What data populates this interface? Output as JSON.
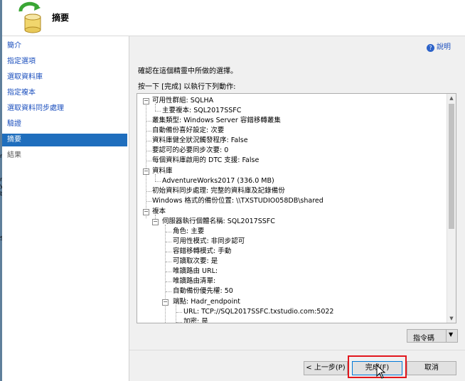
{
  "header": {
    "title": "摘要"
  },
  "edge_text": [
    "n",
    "n",
    "y",
    "b",
    "S"
  ],
  "nav": {
    "items": [
      {
        "label": "簡介",
        "state": "done"
      },
      {
        "label": "指定選項",
        "state": "done"
      },
      {
        "label": "選取資料庫",
        "state": "done"
      },
      {
        "label": "指定複本",
        "state": "done"
      },
      {
        "label": "選取資料同步處理",
        "state": "done"
      },
      {
        "label": "驗證",
        "state": "done"
      },
      {
        "label": "摘要",
        "state": "active"
      },
      {
        "label": "結果",
        "state": "future"
      }
    ]
  },
  "help": {
    "label": "說明"
  },
  "main": {
    "confirm_text": "確認在這個精靈中所做的選擇。",
    "instruction": "按一下 [完成] 以執行下列動作:"
  },
  "tree": {
    "nodes": [
      {
        "text": "可用性群組: SQLHA",
        "level": 0,
        "expander": "-"
      },
      {
        "text": "主要複本: SQL2017SSFC",
        "level": 1
      },
      {
        "text": "叢集類型: Windows Server 容錯移轉叢集",
        "level": 0
      },
      {
        "text": "自動備份喜好設定: 次要",
        "level": 0
      },
      {
        "text": "資料庫健全狀況觸發程序: False",
        "level": 0
      },
      {
        "text": "要認可的必要同步次要: 0",
        "level": 0
      },
      {
        "text": "每個資料庫啟用的 DTC 支援: False",
        "level": 0
      },
      {
        "text": "資料庫",
        "level": 0,
        "expander": "-"
      },
      {
        "text": "AdventureWorks2017 (336.0 MB)",
        "level": 1
      },
      {
        "text": "初始資料同步處理: 完整的資料庫及記錄備份",
        "level": 0
      },
      {
        "text": "Windows 格式的備份位置: \\\\TXSTUDIO058DB\\shared",
        "level": 0
      },
      {
        "text": "複本",
        "level": 0,
        "expander": "-"
      },
      {
        "text": "伺服器執行個體名稱: SQL2017SSFC",
        "level": 1,
        "expander": "-"
      },
      {
        "text": "角色: 主要",
        "level": 2
      },
      {
        "text": "可用性模式: 非同步認可",
        "level": 2
      },
      {
        "text": "容錯移轉模式: 手動",
        "level": 2
      },
      {
        "text": "可讀取次要: 是",
        "level": 2
      },
      {
        "text": "唯讀路由 URL:",
        "level": 2
      },
      {
        "text": "唯讀路由清單:",
        "level": 2
      },
      {
        "text": "自動備份優先權: 50",
        "level": 2
      },
      {
        "text": "端點: Hadr_endpoint",
        "level": 2,
        "expander": "-"
      },
      {
        "text": "URL: TCP://SQL2017SSFC.txstudio.com:5022",
        "level": 3
      },
      {
        "text": "加密: 是",
        "level": 3
      }
    ]
  },
  "buttons": {
    "script": "指令碼",
    "back": "< 上一步(P)",
    "finish": "完成(F)",
    "cancel": "取消"
  },
  "colors": {
    "nav_active_bg": "#1f6ebd",
    "link": "#1b4fbe",
    "highlight_box": "#e2161d"
  }
}
